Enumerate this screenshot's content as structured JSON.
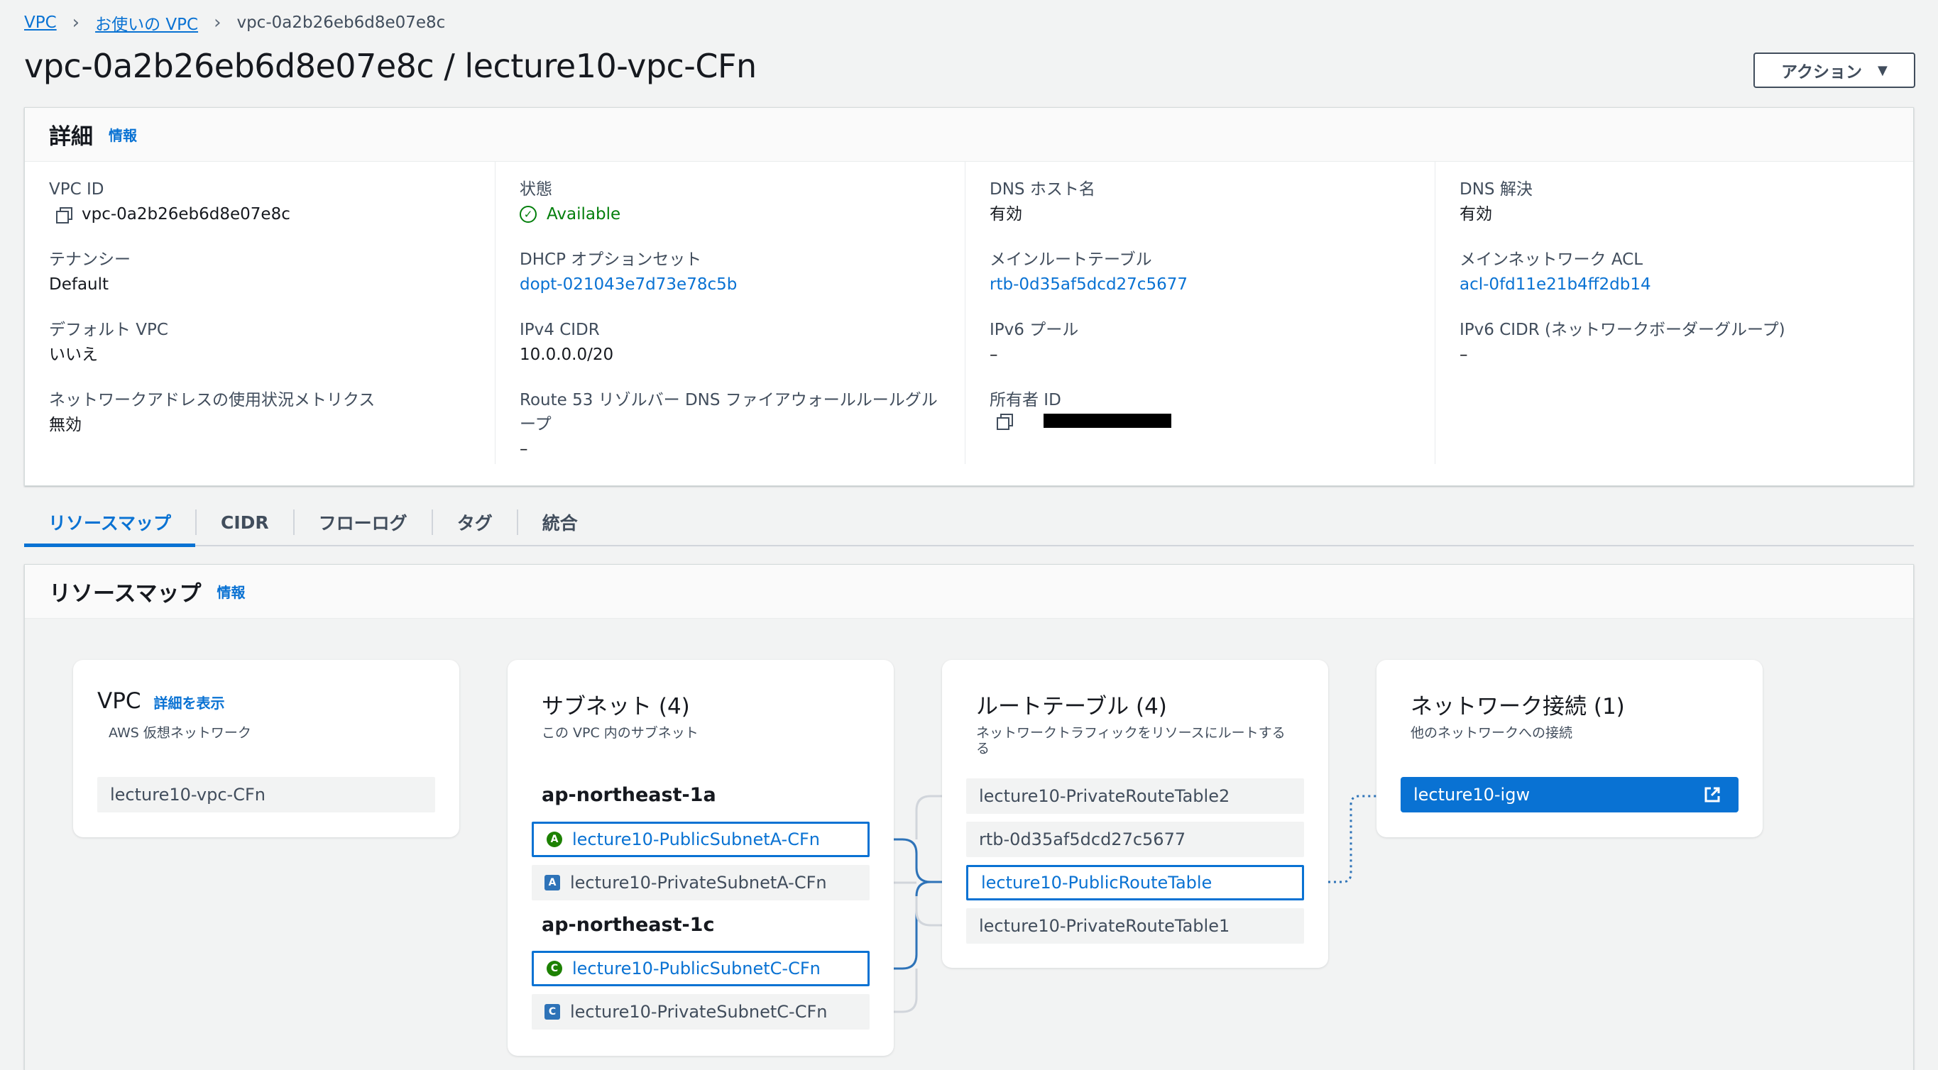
{
  "breadcrumb": {
    "items": [
      "VPC",
      "お使いの VPC"
    ],
    "current": "vpc-0a2b26eb6d8e07e8c"
  },
  "page": {
    "title": "vpc-0a2b26eb6d8e07e8c / lecture10-vpc-CFn",
    "action_label": "アクション"
  },
  "details": {
    "title": "詳細",
    "info": "情報",
    "col1": {
      "vpc_id_label": "VPC ID",
      "vpc_id_value": "vpc-0a2b26eb6d8e07e8c",
      "tenancy_label": "テナンシー",
      "tenancy_value": "Default",
      "default_vpc_label": "デフォルト VPC",
      "default_vpc_value": "いいえ",
      "metrics_label": "ネットワークアドレスの使用状況メトリクス",
      "metrics_value": "無効"
    },
    "col2": {
      "state_label": "状態",
      "state_value": "Available",
      "dhcp_label": "DHCP オプションセット",
      "dhcp_value": "dopt-021043e7d73e78c5b",
      "ipv4_label": "IPv4 CIDR",
      "ipv4_value": "10.0.0.0/20",
      "route53_label_1": "Route 53 リゾルバー DNS ファイアウォールルールグル",
      "route53_label_2": "ープ",
      "route53_value": "–"
    },
    "col3": {
      "dns_host_label": "DNS ホスト名",
      "dns_host_value": "有効",
      "main_rt_label": "メインルートテーブル",
      "main_rt_value": "rtb-0d35af5dcd27c5677",
      "ipv6_pool_label": "IPv6 プール",
      "ipv6_pool_value": "–",
      "owner_label": "所有者 ID"
    },
    "col4": {
      "dns_res_label": "DNS 解決",
      "dns_res_value": "有効",
      "main_acl_label": "メインネットワーク ACL",
      "main_acl_value": "acl-0fd11e21b4ff2db14",
      "ipv6_cidr_label": "IPv6 CIDR (ネットワークボーダーグループ)",
      "ipv6_cidr_value": "–"
    }
  },
  "tabs": [
    "リソースマップ",
    "CIDR",
    "フローログ",
    "タグ",
    "統合"
  ],
  "resource_map": {
    "title": "リソースマップ",
    "info": "情報",
    "vpc_card": {
      "title": "VPC",
      "link": "詳細を表示",
      "subtitle": "AWS 仮想ネットワーク",
      "item": "lecture10-vpc-CFn"
    },
    "subnet_card": {
      "title": "サブネット (4)",
      "subtitle": "この VPC 内のサブネット",
      "az1": "ap-northeast-1a",
      "az2": "ap-northeast-1c",
      "items": [
        {
          "badge": "A",
          "name": "lecture10-PublicSubnetA-CFn"
        },
        {
          "badge": "A",
          "name": "lecture10-PrivateSubnetA-CFn"
        },
        {
          "badge": "C",
          "name": "lecture10-PublicSubnetC-CFn"
        },
        {
          "badge": "C",
          "name": "lecture10-PrivateSubnetC-CFn"
        }
      ]
    },
    "rt_card": {
      "title": "ルートテーブル (4)",
      "subtitle_1": "ネットワークトラフィックをリソースにルートする",
      "subtitle_2": "る",
      "items": [
        "lecture10-PrivateRouteTable2",
        "rtb-0d35af5dcd27c5677",
        "lecture10-PublicRouteTable",
        "lecture10-PrivateRouteTable1"
      ]
    },
    "net_card": {
      "title": "ネットワーク接続 (1)",
      "subtitle": "他のネットワークへの接続",
      "item": "lecture10-igw"
    }
  },
  "colors": {
    "link": "#0972d3",
    "success": "#037f0c",
    "badge_green": "#1d8102",
    "badge_blue": "#2e73b8"
  }
}
